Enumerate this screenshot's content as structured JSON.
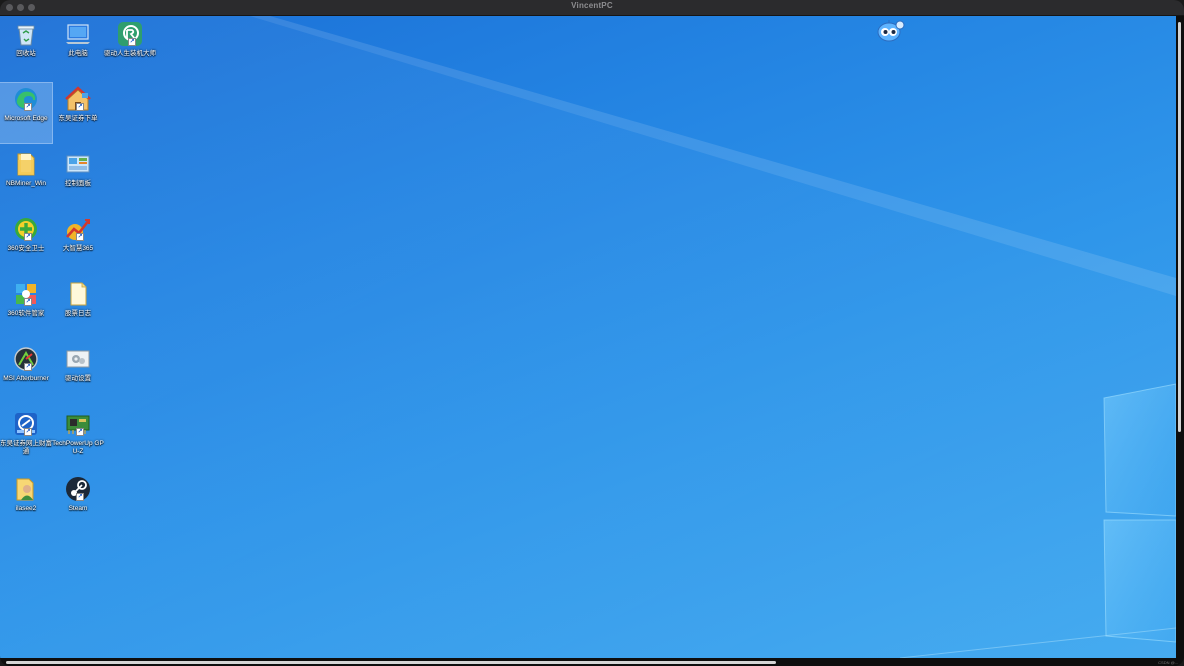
{
  "window": {
    "title": "VincentPC",
    "watermark": "CSDN @..."
  },
  "desktop": {
    "icons": [
      {
        "id": "recycle-bin",
        "label": "回收站",
        "icon": "recycle-bin-icon",
        "shortcut": false,
        "selected": false
      },
      {
        "id": "this-pc",
        "label": "此电脑",
        "icon": "computer-icon",
        "shortcut": false,
        "selected": false
      },
      {
        "id": "driver-genius",
        "label": "驱动人生装机大师",
        "icon": "driver-app-icon",
        "shortcut": true,
        "selected": false
      },
      {
        "id": "microsoft-edge",
        "label": "Microsoft Edge",
        "icon": "edge-icon",
        "shortcut": true,
        "selected": true
      },
      {
        "id": "dongfang-securities",
        "label": "东吴证券下单",
        "icon": "house-app-icon",
        "shortcut": true,
        "selected": false
      },
      {
        "id": "nbminer",
        "label": "NBMiner_Win",
        "icon": "folder-icon",
        "shortcut": false,
        "selected": false
      },
      {
        "id": "control-panel",
        "label": "控制面板",
        "icon": "control-panel-icon",
        "shortcut": false,
        "selected": false
      },
      {
        "id": "360-safe",
        "label": "360安全卫士",
        "icon": "360-safe-icon",
        "shortcut": true,
        "selected": false
      },
      {
        "id": "dazhihui",
        "label": "大智慧365",
        "icon": "stock-chart-icon",
        "shortcut": true,
        "selected": false
      },
      {
        "id": "360-soft",
        "label": "360软件管家",
        "icon": "360-soft-icon",
        "shortcut": true,
        "selected": false
      },
      {
        "id": "stock-log",
        "label": "股票日志",
        "icon": "document-icon",
        "shortcut": false,
        "selected": false
      },
      {
        "id": "msi-afterburner",
        "label": "MSI Afterburner",
        "icon": "afterburner-icon",
        "shortcut": true,
        "selected": false
      },
      {
        "id": "driver-settings",
        "label": "驱动设置",
        "icon": "settings-icon",
        "shortcut": false,
        "selected": false
      },
      {
        "id": "dongfang-wealth",
        "label": "东吴证券网上财富通",
        "icon": "securities-app-icon",
        "shortcut": true,
        "selected": false
      },
      {
        "id": "gpu-z",
        "label": "TechPowerUp GPU-Z",
        "icon": "gpu-card-icon",
        "shortcut": true,
        "selected": false
      },
      {
        "id": "ilasee2",
        "label": "ilasee2",
        "icon": "user-folder-icon",
        "shortcut": false,
        "selected": false
      },
      {
        "id": "steam",
        "label": "Steam",
        "icon": "steam-icon",
        "shortcut": true,
        "selected": false
      }
    ],
    "mascot": "robot-mascot-icon"
  },
  "colors": {
    "desktop_blue": "#2383e2",
    "titlebar": "#2b2b2d"
  }
}
